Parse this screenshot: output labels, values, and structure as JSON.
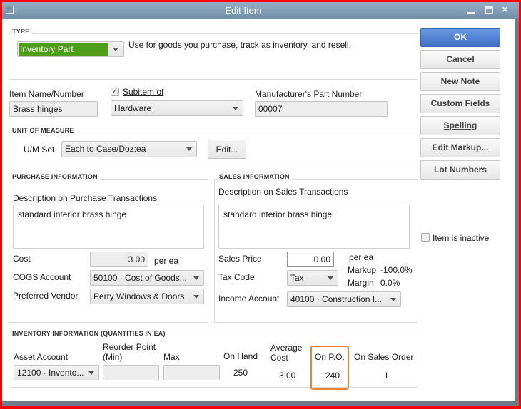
{
  "window": {
    "title": "Edit Item"
  },
  "type": {
    "group_label": "TYPE",
    "selected": "Inventory Part",
    "description": "Use for goods you purchase, track as inventory, and resell.",
    "accent": "#4f9e1a"
  },
  "buttons": {
    "ok": "OK",
    "cancel": "Cancel",
    "new_note": "New Note",
    "custom_fields": "Custom Fields",
    "spelling": "Spelling",
    "edit_markup": "Edit Markup...",
    "lot_numbers": "Lot Numbers"
  },
  "item": {
    "name_label": "Item Name/Number",
    "name_value": "Brass hinges",
    "subitem_label": "Subitem of",
    "subitem_checked": true,
    "subitem_value": "Hardware",
    "mfr_label": "Manufacturer's Part Number",
    "mfr_value": "00007"
  },
  "uom": {
    "group_label": "UNIT OF MEASURE",
    "set_label": "U/M Set",
    "set_value": "Each to Case/Doz:ea",
    "edit_label": "Edit..."
  },
  "purchase": {
    "group_label": "PURCHASE INFORMATION",
    "desc_label": "Description on Purchase Transactions",
    "desc_value": "standard interior brass hinge",
    "cost_label": "Cost",
    "cost_value": "3.00",
    "cost_unit": "per ea",
    "cogs_label": "COGS Account",
    "cogs_value": "50100 · Cost of Goods...",
    "vendor_label": "Preferred Vendor",
    "vendor_value": "Perry Windows & Doors"
  },
  "sales": {
    "group_label": "SALES INFORMATION",
    "desc_label": "Description on Sales Transactions",
    "desc_value": "standard interior brass hinge",
    "price_label": "Sales Price",
    "price_value": "0.00",
    "price_unit": "per ea",
    "markup_label": "Markup",
    "markup_value": "-100.0%",
    "margin_label": "Margin",
    "margin_value": "0.0%",
    "tax_label": "Tax Code",
    "tax_value": "Tax",
    "income_label": "Income Account",
    "income_value": "40100 · Construction I..."
  },
  "inactive": {
    "label": "Item is inactive",
    "checked": false
  },
  "inventory": {
    "group_label": "INVENTORY INFORMATION (QUANTITIES IN EA)",
    "asset_label": "Asset Account",
    "asset_value": "12100 · Invento...",
    "reorder_label_1": "Reorder Point",
    "reorder_label_2": "(Min)",
    "reorder_value": "",
    "max_label": "Max",
    "max_value": "",
    "on_hand_label": "On Hand",
    "on_hand_value": "250",
    "avg_cost_label_1": "Average",
    "avg_cost_label_2": "Cost",
    "avg_cost_value": "3.00",
    "on_po_label": "On P.O.",
    "on_po_value": "240",
    "on_so_label": "On Sales Order",
    "on_so_value": "1",
    "highlight": "#e8843a"
  }
}
